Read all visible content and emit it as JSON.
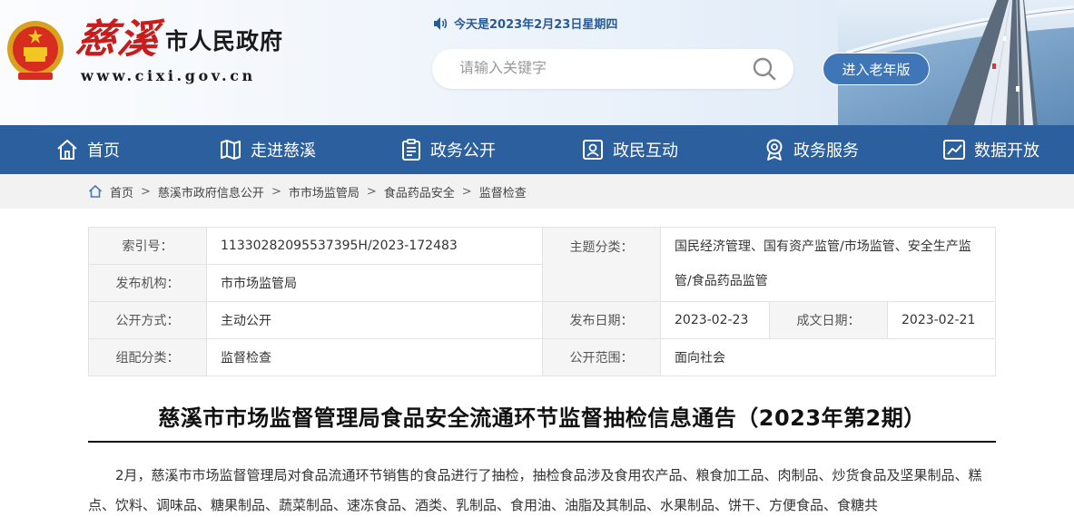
{
  "header": {
    "logo_script": "慈溪",
    "logo_gov": "市人民政府",
    "logo_url": "www.cixi.gov.cn",
    "date_text": "今天是2023年2月23日星期四",
    "search_placeholder": "请输入关键字",
    "elder_mode_label": "进入老年版"
  },
  "nav": {
    "items": [
      {
        "label": "首页",
        "icon": "home-icon"
      },
      {
        "label": "走进慈溪",
        "icon": "map-icon"
      },
      {
        "label": "政务公开",
        "icon": "document-icon"
      },
      {
        "label": "政民互动",
        "icon": "contact-icon"
      },
      {
        "label": "政务服务",
        "icon": "service-icon"
      },
      {
        "label": "数据开放",
        "icon": "chart-icon"
      }
    ]
  },
  "breadcrumb": [
    "首页",
    "慈溪市政府信息公开",
    "市市场监管局",
    "食品药品安全",
    "监督检查"
  ],
  "info": {
    "index_label": "索引号：",
    "index_value": "11330282095537395H/2023-172483",
    "topic_label": "主题分类：",
    "topic_value": "国民经济管理、国有资产监管/市场监管、安全生产监管/食品药品监管",
    "publisher_label": "发布机构：",
    "publisher_value": "市市场监管局",
    "method_label": "公开方式：",
    "method_value": "主动公开",
    "pubdate_label": "发布日期：",
    "pubdate_value": "2023-02-23",
    "created_label": "成文日期：",
    "created_value": "2023-02-21",
    "category_label": "组配分类：",
    "category_value": "监督检查",
    "scope_label": "公开范围：",
    "scope_value": "面向社会"
  },
  "article": {
    "title": "慈溪市市场监督管理局食品安全流通环节监督抽检信息通告（2023年第2期）",
    "body": "2月，慈溪市市场监督管理局对食品流通环节销售的食品进行了抽检，抽检食品涉及食用农产品、粮食加工品、肉制品、炒货食品及坚果制品、糕点、饮料、调味品、糖果制品、蔬菜制品、速冻食品、酒类、乳制品、食用油、油脂及其制品、水果制品、饼干、方便食品、食糖共"
  },
  "colors": {
    "nav_bg": "#2b5f9e",
    "brand_red": "#c81d1d",
    "elder_btn": "#3f76b8"
  }
}
